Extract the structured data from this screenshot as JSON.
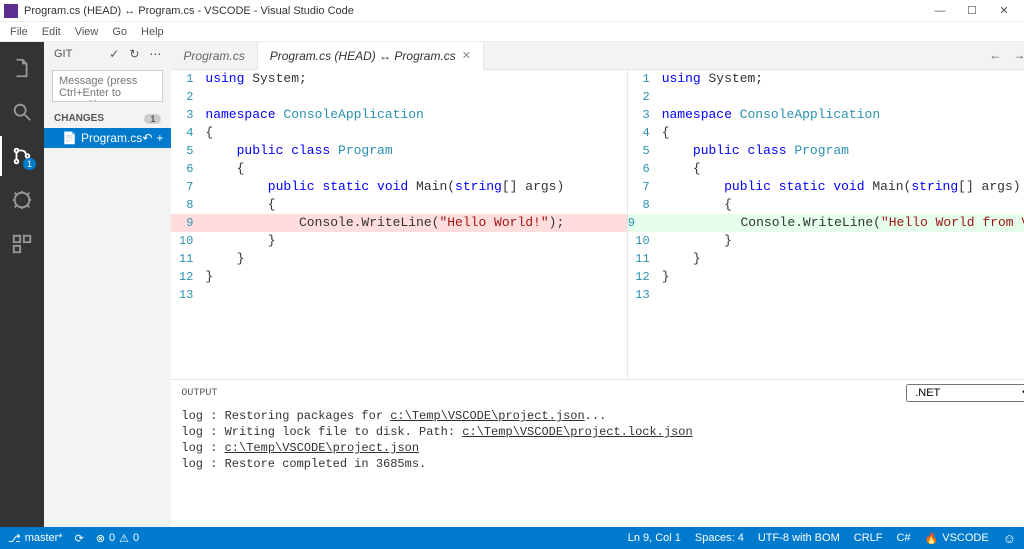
{
  "title": "Program.cs (HEAD) ↔ Program.cs - VSCODE - Visual Studio Code",
  "menu": {
    "file": "File",
    "edit": "Edit",
    "view": "View",
    "go": "Go",
    "help": "Help"
  },
  "sidebar": {
    "header": "GIT",
    "commit_placeholder": "Message (press Ctrl+Enter to commit)",
    "changes_label": "CHANGES",
    "changes_count": "1",
    "file_name": "Program.cs"
  },
  "tabs": {
    "tab1": "Program.cs",
    "tab2": "Program.cs (HEAD) ↔ Program.cs"
  },
  "editor": {
    "left": {
      "l1": {
        "n": "1",
        "using": "using",
        "sys": " System;"
      },
      "l2": {
        "n": "2"
      },
      "l3": {
        "n": "3",
        "ns": "namespace",
        "app": " ConsoleApplication"
      },
      "l4": {
        "n": "4",
        "b": "{"
      },
      "l5": {
        "n": "5",
        "pub": "    public",
        "cl": " class",
        "prg": " Program"
      },
      "l6": {
        "n": "6",
        "b": "    {"
      },
      "l7": {
        "n": "7",
        "psv": "        public static void",
        "main": " Main(",
        "strarr": "string",
        "rest": "[] args)"
      },
      "l8": {
        "n": "8",
        "b": "        {"
      },
      "l9": {
        "n": "9",
        "pre": "            Console.WriteLine(",
        "str": "\"Hello World!\"",
        "post": ");"
      },
      "l10": {
        "n": "10",
        "b": "        }"
      },
      "l11": {
        "n": "11",
        "b": "    }"
      },
      "l12": {
        "n": "12",
        "b": "}"
      },
      "l13": {
        "n": "13"
      }
    },
    "right": {
      "l1": {
        "n": "1",
        "using": "using",
        "sys": " System;"
      },
      "l2": {
        "n": "2"
      },
      "l3": {
        "n": "3",
        "ns": "namespace",
        "app": " ConsoleApplication"
      },
      "l4": {
        "n": "4",
        "b": "{"
      },
      "l5": {
        "n": "5",
        "pub": "    public",
        "cl": " class",
        "prg": " Program"
      },
      "l6": {
        "n": "6",
        "b": "    {"
      },
      "l7": {
        "n": "7",
        "psv": "        public static void",
        "main": " Main(",
        "strarr": "string",
        "rest": "[] args)"
      },
      "l8": {
        "n": "8",
        "b": "        {"
      },
      "l9": {
        "n": "9",
        "pre": "            Console.WriteLine(",
        "str": "\"Hello World from VSCODE to VSTS",
        "post": ""
      },
      "l10": {
        "n": "10",
        "b": "        }"
      },
      "l11": {
        "n": "11",
        "b": "    }"
      },
      "l12": {
        "n": "12",
        "b": "}"
      },
      "l13": {
        "n": "13"
      }
    }
  },
  "output": {
    "label": "OUTPUT",
    "select": ".NET",
    "l1a": "log  : Restoring packages for ",
    "l1b": "c:\\Temp\\VSCODE\\project.json",
    "l1c": "...",
    "l2a": "log  : Writing lock file to disk. Path: ",
    "l2b": "c:\\Temp\\VSCODE\\project.lock.json",
    "l3a": "log  : ",
    "l3b": "c:\\Temp\\VSCODE\\project.json",
    "l4": "log  : Restore completed in 3685ms."
  },
  "status": {
    "branch": "master*",
    "errors": "0",
    "warnings": "0",
    "pos": "Ln 9, Col 1",
    "spaces": "Spaces: 4",
    "enc": "UTF-8 with BOM",
    "eol": "CRLF",
    "lang": "C#",
    "vscode": "VSCODE"
  },
  "activity_badge": "1"
}
